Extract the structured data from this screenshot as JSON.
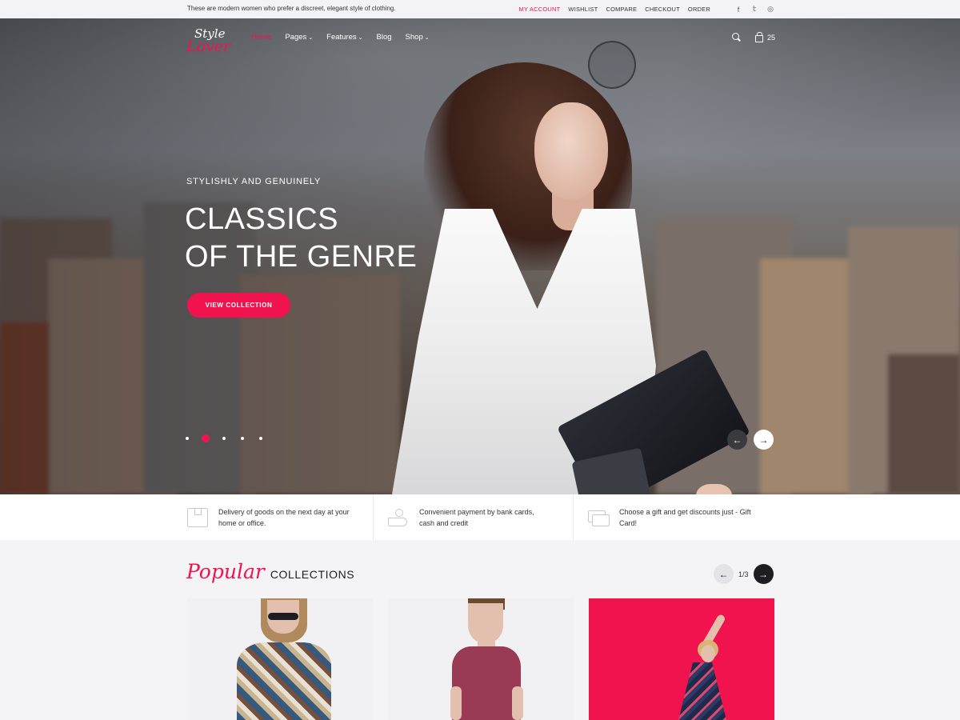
{
  "topbar": {
    "tagline": "These are modern women who prefer a discreet, elegant style of clothing.",
    "links": [
      {
        "label": "MY ACCOUNT",
        "active": true
      },
      {
        "label": "WISHLIST"
      },
      {
        "label": "COMPARE"
      },
      {
        "label": "CHECKOUT"
      },
      {
        "label": "ORDER"
      }
    ],
    "social": [
      "facebook-icon",
      "twitter-icon",
      "instagram-icon"
    ],
    "social_glyphs": [
      "f",
      "𝕥",
      "◎"
    ]
  },
  "logo": {
    "line1": "Style",
    "line2": "Lover"
  },
  "nav": {
    "items": [
      {
        "label": "Home",
        "active": true
      },
      {
        "label": "Pages",
        "dropdown": true
      },
      {
        "label": "Features",
        "dropdown": true
      },
      {
        "label": "Blog"
      },
      {
        "label": "Shop",
        "dropdown": true
      }
    ],
    "chevron": "⌄",
    "cart_count": "25"
  },
  "hero": {
    "eyebrow": "STYLISHLY AND GENUINELY",
    "headline_line1": "CLASSICS",
    "headline_line2": "OF THE GENRE",
    "cta": "VIEW COLLECTION",
    "slides_total": 5,
    "active_slide": 2,
    "prev_glyph": "←",
    "next_glyph": "→"
  },
  "features": [
    {
      "icon": "box-icon",
      "text": "Delivery of goods on the next day at your home or office."
    },
    {
      "icon": "hand-payment-icon",
      "text": "Convenient payment by bank cards, cash and credit"
    },
    {
      "icon": "gift-card-icon",
      "text": "Choose a gift and get discounts just - Gift Card!"
    }
  ],
  "popular": {
    "script": "Popular",
    "caps": "COLLECTIONS",
    "page": "1/3",
    "prev_glyph": "←",
    "next_glyph": "→"
  },
  "colors": {
    "accent": "#f0134d",
    "dark": "#1d1d22",
    "light_bg": "#f4f4f7"
  }
}
